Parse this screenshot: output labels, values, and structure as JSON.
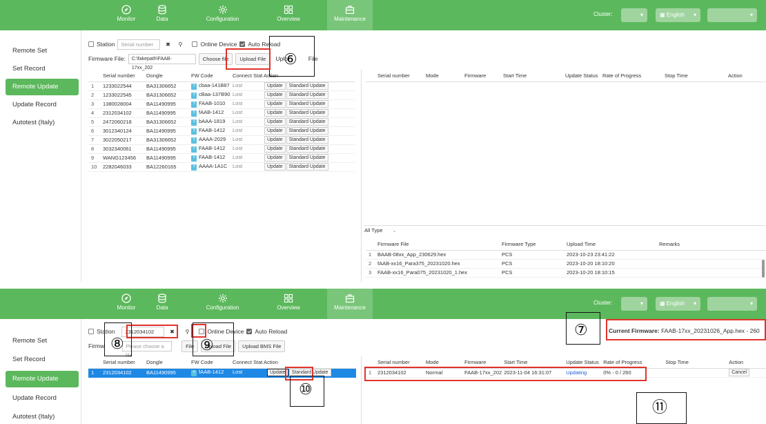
{
  "nav": {
    "items": [
      {
        "label": "Monitor",
        "icon": "compass-icon"
      },
      {
        "label": "Data",
        "icon": "database-icon"
      },
      {
        "label": "Configuration",
        "icon": "gear-icon"
      },
      {
        "label": "Overview",
        "icon": "grid-icon"
      },
      {
        "label": "Maintenance",
        "icon": "briefcase-icon"
      }
    ],
    "cluster_label": "Cluster:",
    "language": "English"
  },
  "sidebar": {
    "items": [
      "Remote Set",
      "Set Record",
      "Remote Update",
      "Update Record",
      "Autotest (Italy)"
    ],
    "active": "Remote Update"
  },
  "top": {
    "station_label": "Station",
    "serial_placeholder": "Serial number",
    "online_label": "Online Device",
    "auto_reload_label": "Auto Reload",
    "firmware_file_label": "Firmware File:",
    "firmware_path": "C:\\fakepath\\FAAB-17xx_202",
    "choose_file": "Choose file",
    "upload_file": "Upload File",
    "upload_bms_partial_left": "Uplo",
    "upload_bms_partial_right": "File",
    "callout_num": "⑥",
    "device_cols": [
      "Serial number",
      "Dongle",
      "FW Code",
      "Connect State",
      "Action"
    ],
    "device_cols_overlap": "Connect Stat Action",
    "devices": [
      {
        "serial": "1233022544",
        "dongle": "BA31306652",
        "fw": "cbaa-141B87",
        "state": "Lost"
      },
      {
        "serial": "1233022545",
        "dongle": "BA31306652",
        "fw": "cBaa-137B90",
        "state": "Lost"
      },
      {
        "serial": "1380028004",
        "dongle": "BA11490995",
        "fw": "FAAB-1010",
        "state": "Lost"
      },
      {
        "serial": "2312034102",
        "dongle": "BA11490995",
        "fw": "fAAB-1412",
        "state": "Lost"
      },
      {
        "serial": "2472060218",
        "dongle": "BA31306652",
        "fw": "bAAA-1819",
        "state": "Lost"
      },
      {
        "serial": "3012340124",
        "dongle": "BA11490995",
        "fw": "FAAB-1412",
        "state": "Lost"
      },
      {
        "serial": "3022050217",
        "dongle": "BA31306652",
        "fw": "AAAA-2029",
        "state": "Lost"
      },
      {
        "serial": "3032340061",
        "dongle": "BA11490995",
        "fw": "FAAB-1412",
        "state": "Lost"
      },
      {
        "serial": "WANG123456",
        "dongle": "BA11490995",
        "fw": "FAAB-1412",
        "state": "Lost"
      },
      {
        "serial": "2282046033",
        "dongle": "BA12260165",
        "fw": "AAAA-1A1C",
        "state": "Lost"
      }
    ],
    "update_btn": "Update",
    "standard_update_btn": "Standard Update",
    "task_cols": [
      "Serial number",
      "Mode",
      "Firmware",
      "Start Time",
      "Update Status",
      "Rate of Progress",
      "Stop Time",
      "Action"
    ],
    "type_filter": "All Type",
    "fw_cols": [
      "Firmware File",
      "Firmware Type",
      "Upload Time",
      "Remarks"
    ],
    "fw_files": [
      {
        "file": "BAAB-08xx_App_230629.hex",
        "type": "PCS",
        "time": "2023-10-23 23:41:22"
      },
      {
        "file": "fAAB-xx16_Para375_20231020.hex",
        "type": "PCS",
        "time": "2023-10-20 18:10:20"
      },
      {
        "file": "FAAB-xx16_Para075_20231020_1.hex",
        "type": "PCS",
        "time": "2023-10-20 18:10:15"
      }
    ]
  },
  "bottom": {
    "station_label": "Station",
    "serial_value": "2312034102",
    "online_label": "Online Device",
    "auto_reload_label": "Auto Reload",
    "firmware_partial": "Firmw",
    "file_placeholder": "Please choose a file",
    "choose_file_partial": "File",
    "upload_file": "Upload File",
    "upload_bms": "Upload BMS File",
    "current_fw_label": "Current Firmware:",
    "current_fw_value": "FAAB-17xx_20231026_App.hex - 260",
    "device": {
      "serial": "2312034102",
      "dongle": "BA11490995",
      "fw": "fAAB-1412",
      "state": "Lost"
    },
    "device_cols": [
      "Serial number",
      "Dongle",
      "FW Code",
      "Connect State",
      "Action"
    ],
    "device_cols_overlap": "Connect Stat Action",
    "update_btn": "Update",
    "standard_update_btn": "Standard Update",
    "task_cols": [
      "Serial number",
      "Mode",
      "Firmware",
      "Start Time",
      "Update Status",
      "Rate of Progress",
      "Stop Time",
      "Action"
    ],
    "task": {
      "serial": "2312034102",
      "mode": "Normal",
      "firmware": "FAAB-17xx_202",
      "start": "2023-11-04 16:31:07",
      "status": "Updating",
      "progress": "0% - 0 / 260",
      "cancel": "Cancel"
    },
    "callouts": {
      "n7": "⑦",
      "n8": "⑧",
      "n9": "⑨",
      "n10": "⑩",
      "n11": "⑪"
    }
  },
  "colors": {
    "nav_green": "#5cb85c",
    "active_blue": "#1e88e5",
    "callout_red": "#e0322b",
    "status_blue": "#1e5bd6"
  }
}
